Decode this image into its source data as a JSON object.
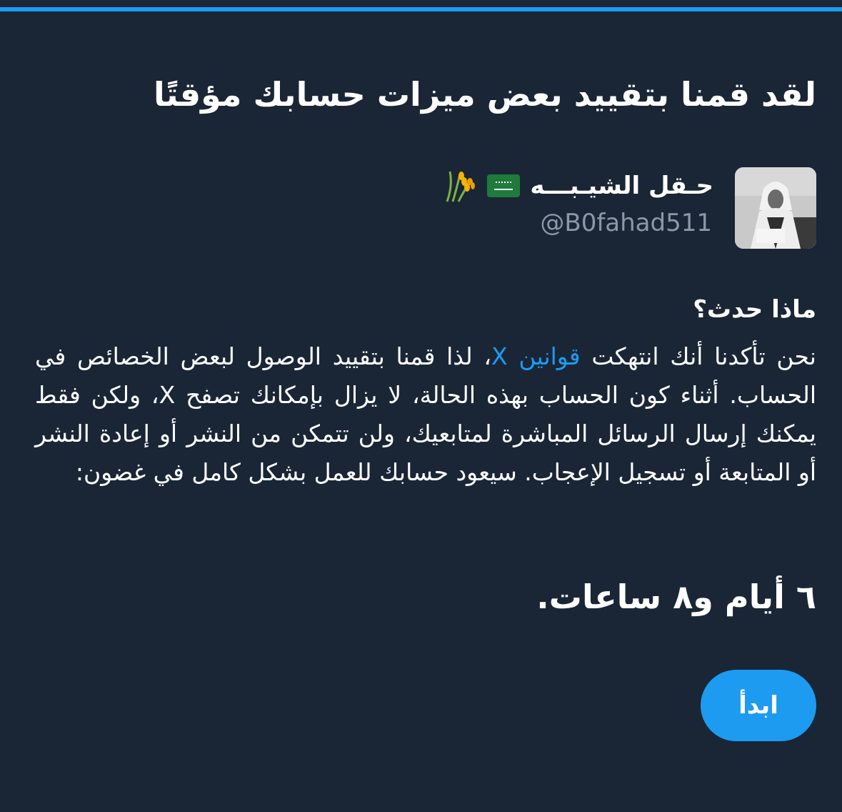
{
  "title": "لقد قمنا بتقييد بعض ميزات حسابك مؤقتًا",
  "user": {
    "name": "حـقل الشيـبـــه",
    "handle": "@B0fahad511",
    "badges": [
      "saudi-flag-icon",
      "rice-icon"
    ]
  },
  "section": {
    "heading": "ماذا حدث؟",
    "body_part1": "نحن تأكدنا أنك انتهكت ",
    "link_text": "قوانين X",
    "body_part2": "، لذا قمنا بتقييد الوصول لبعض الخصائص في الحساب. أثناء كون الحساب بهذه الحالة، لا يزال بإمكانك تصفح X، ولكن فقط يمكنك إرسال الرسائل المباشرة لمتابعيك، ولن تتمكن من النشر أو إعادة النشر أو المتابعة أو تسجيل الإعجاب. سيعود حسابك للعمل بشكل كامل في غضون:"
  },
  "duration": "٦ أيام و٨ ساعات.",
  "button": {
    "label": "ابدأ"
  },
  "colors": {
    "background": "#1a2636",
    "accent": "#1d9bf0",
    "secondary_text": "#8b98a5"
  }
}
